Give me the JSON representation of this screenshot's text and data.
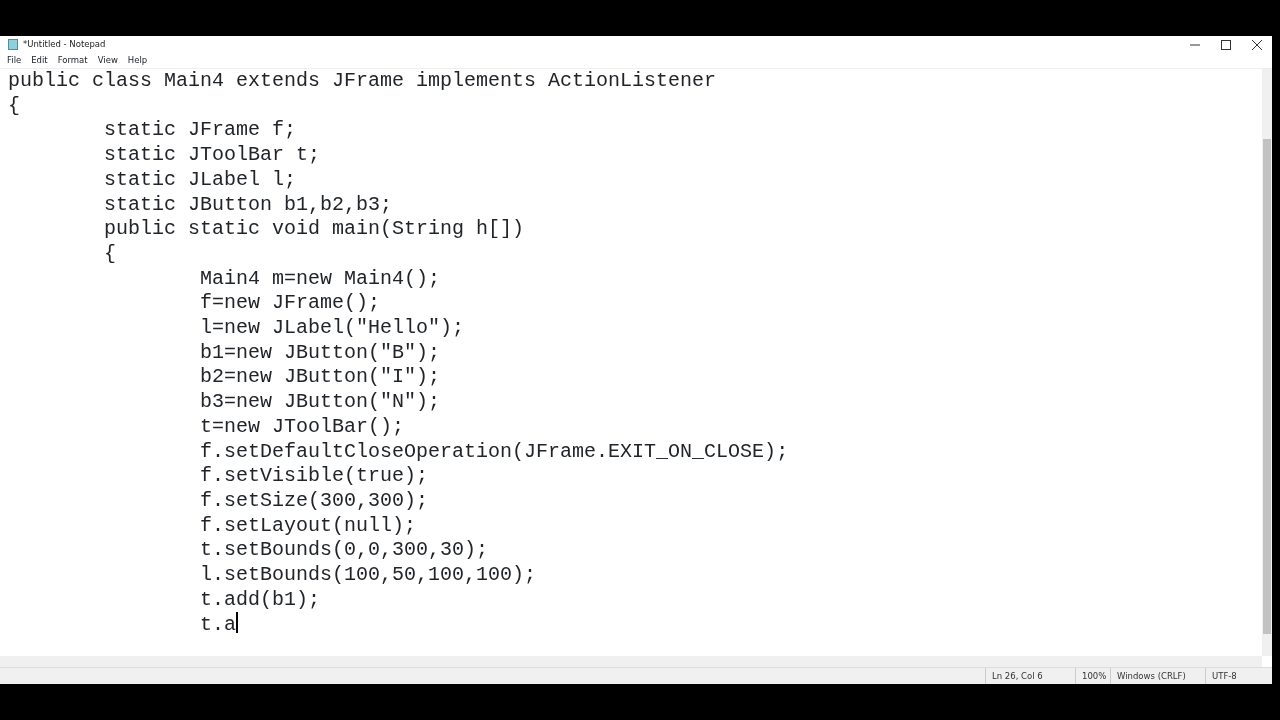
{
  "window": {
    "title": "*Untitled - Notepad"
  },
  "menu": [
    "File",
    "Edit",
    "Format",
    "View",
    "Help"
  ],
  "editor": {
    "lines": [
      "public class Main4 extends JFrame implements ActionListener",
      "{",
      "\tstatic JFrame f;",
      "\tstatic JToolBar t;",
      "\tstatic JLabel l;",
      "\tstatic JButton b1,b2,b3;",
      "\tpublic static void main(String h[])",
      "\t{",
      "\t\tMain4 m=new Main4();",
      "\t\tf=new JFrame();",
      "\t\tl=new JLabel(\"Hello\");",
      "\t\tb1=new JButton(\"B\");",
      "\t\tb2=new JButton(\"I\");",
      "\t\tb3=new JButton(\"N\");",
      "\t\tt=new JToolBar();",
      "\t\tf.setDefaultCloseOperation(JFrame.EXIT_ON_CLOSE);",
      "\t\tf.setVisible(true);",
      "\t\tf.setSize(300,300);",
      "\t\tf.setLayout(null);",
      "\t\tt.setBounds(0,0,300,30);",
      "\t\tl.setBounds(100,50,100,100);",
      "\t\tt.add(b1);",
      "\t\tt.a"
    ]
  },
  "status_bar": [
    "Ln 26, Col 6",
    "100%",
    "Windows (CRLF)",
    "UTF-8"
  ]
}
